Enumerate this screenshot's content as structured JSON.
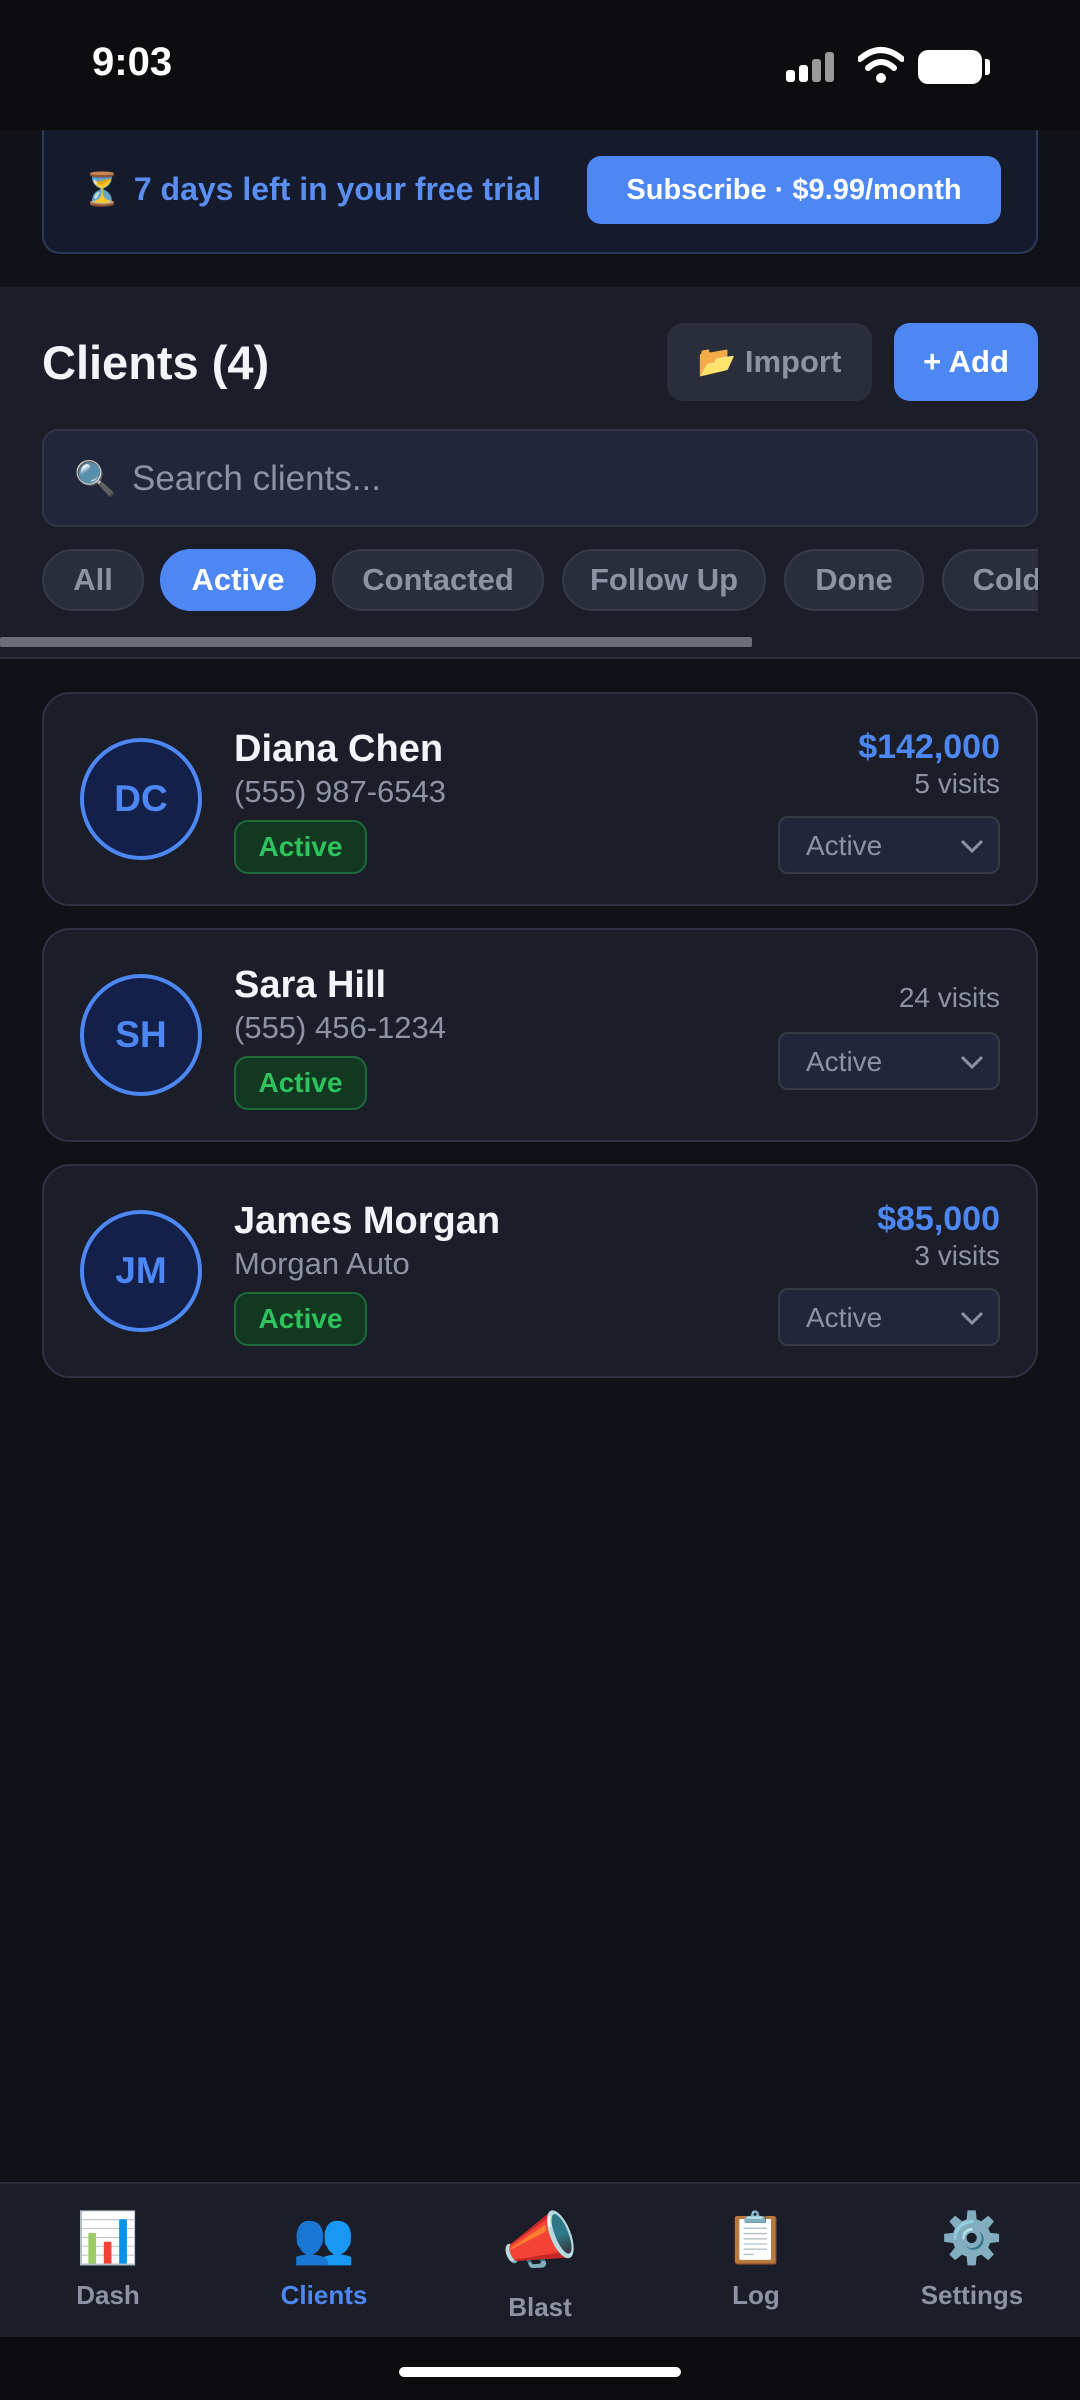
{
  "status_bar": {
    "time": "9:03"
  },
  "trial_banner": {
    "icon": "⏳",
    "text": "7 days left in your free trial",
    "subscribe_label": "Subscribe · $9.99/month"
  },
  "header": {
    "title": "Clients (4)",
    "import_label": "📂 Import",
    "add_label": "+ Add"
  },
  "search": {
    "placeholder": "Search clients...",
    "value": "",
    "icon": "🔍"
  },
  "filters": {
    "selected": "Active",
    "chips": [
      "All",
      "Active",
      "Contacted",
      "Follow Up",
      "Done",
      "Cold"
    ]
  },
  "clients": [
    {
      "initials": "DC",
      "name": "Diana Chen",
      "sub": "(555) 987-6543",
      "badge": "Active",
      "value": "$142,000",
      "visits": "5 visits",
      "status": "Active"
    },
    {
      "initials": "SH",
      "name": "Sara Hill",
      "sub": "(555) 456-1234",
      "badge": "Active",
      "value": "",
      "visits": "24 visits",
      "status": "Active"
    },
    {
      "initials": "JM",
      "name": "James Morgan",
      "sub": "Morgan Auto",
      "badge": "Active",
      "value": "$85,000",
      "visits": "3 visits",
      "status": "Active"
    }
  ],
  "nav": [
    {
      "icon": "📊",
      "label": "Dash"
    },
    {
      "icon": "👥",
      "label": "Clients"
    },
    {
      "icon": "📣",
      "label": "Blast"
    },
    {
      "icon": "📋",
      "label": "Log"
    },
    {
      "icon": "⚙️",
      "label": "Settings"
    }
  ],
  "colors": {
    "accent": "#4d87f4",
    "background": "#111217",
    "card": "#1b1e28",
    "active_badge": "#2fc35e"
  }
}
